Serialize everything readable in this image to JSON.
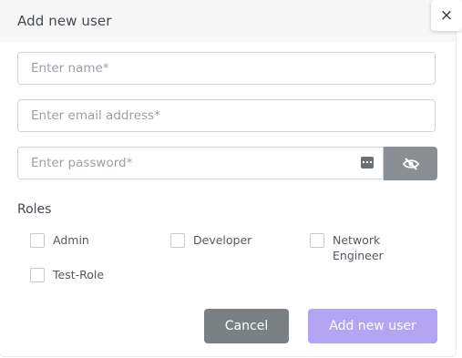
{
  "modal": {
    "title": "Add new user",
    "close_icon": "×"
  },
  "form": {
    "name_placeholder": "Enter name*",
    "email_placeholder": "Enter email address*",
    "password_placeholder": "Enter password*"
  },
  "roles": {
    "label": "Roles",
    "items": [
      {
        "label": "Admin",
        "checked": false
      },
      {
        "label": "Developer",
        "checked": false
      },
      {
        "label": "Network\nEngineer",
        "checked": false
      },
      {
        "label": "Test-Role",
        "checked": false
      }
    ]
  },
  "actions": {
    "cancel_label": "Cancel",
    "add_label": "Add new user"
  },
  "colors": {
    "header_bg": "#f7f7f7",
    "cancel_bg": "#7b8085",
    "add_bg": "#b3a5f2",
    "toggle_bg": "#8a8f95"
  },
  "icons": [
    "close-icon",
    "password-manager-icon",
    "eye-slash-icon"
  ]
}
